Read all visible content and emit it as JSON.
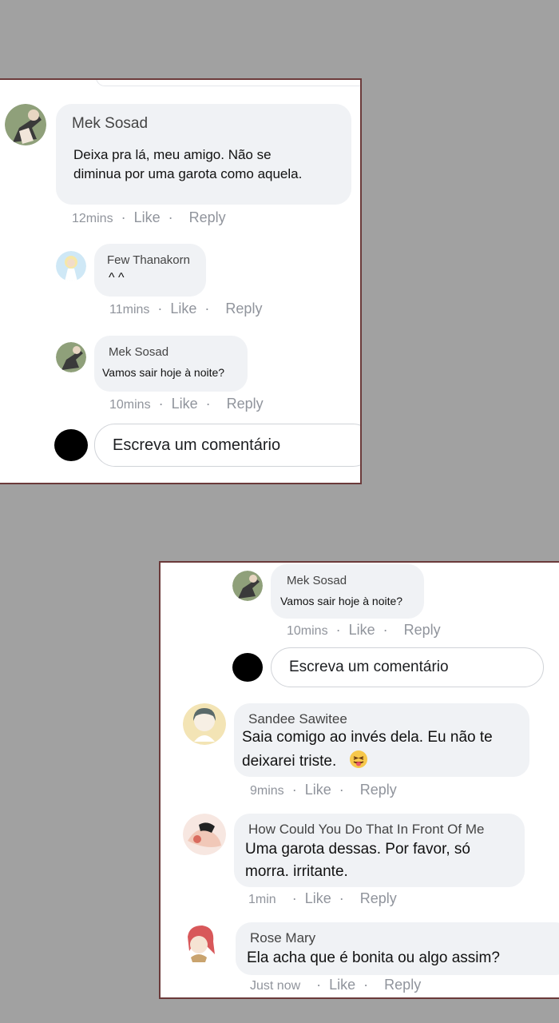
{
  "panel_top": {
    "comment_main": {
      "author": "Mek Sosad",
      "text_line1": "Deixa pra lá, meu amigo. Não se",
      "text_line2": "diminua por uma garota como aquela.",
      "time": "12mins",
      "like": "Like",
      "reply": "Reply"
    },
    "reply1": {
      "author": "Few Thanakorn",
      "text": "^ ^",
      "time": "11mins",
      "like": "Like",
      "reply": "Reply"
    },
    "reply2": {
      "author": "Mek Sosad",
      "text": "Vamos sair hoje à noite?",
      "time": "10mins",
      "like": "Like",
      "reply": "Reply"
    },
    "composer": {
      "placeholder": "Escreva um comentário"
    }
  },
  "panel_bottom": {
    "reply_top": {
      "author": "Mek Sosad",
      "text": "Vamos sair hoje à noite?",
      "time": "10mins",
      "like": "Like",
      "reply": "Reply"
    },
    "composer": {
      "placeholder": "Escreva um comentário"
    },
    "comment1": {
      "author": "Sandee Sawitee",
      "text_line1": "Saia comigo ao invés dela. Eu não te",
      "text_line2": "deixarei triste.",
      "emoji": "face-with-tongue-and-winking-eye",
      "time": "9mins",
      "like": "Like",
      "reply": "Reply"
    },
    "comment2": {
      "author": "How Could You Do That In Front Of Me",
      "text_line1": "Uma garota dessas. Por favor, só",
      "text_line2": "morra. irritante.",
      "time": "1min",
      "like": "Like",
      "reply": "Reply"
    },
    "comment3": {
      "author": "Rose Mary",
      "text": "Ela acha que é bonita ou algo assim?",
      "time": "Just now",
      "like": "Like",
      "reply": "Reply"
    }
  },
  "colors": {
    "background": "#a1a1a1",
    "bubble": "#f0f2f5",
    "panel_border": "#6b3a3a",
    "meta_text": "#90949c"
  }
}
